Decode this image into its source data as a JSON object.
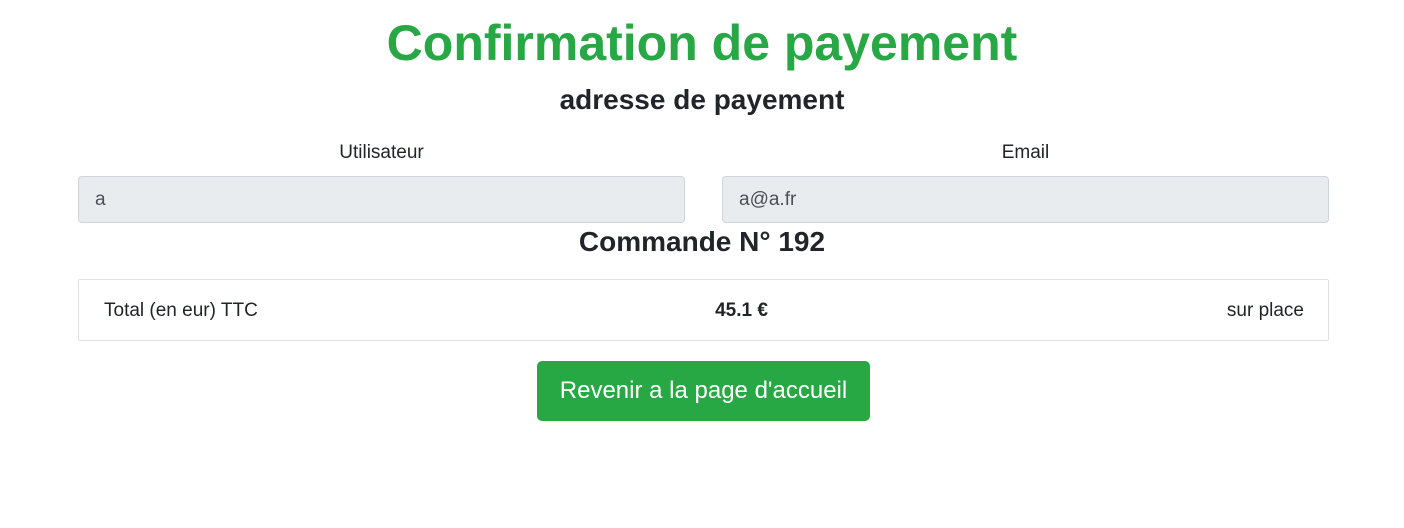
{
  "page": {
    "title": "Confirmation de payement",
    "subtitle": "adresse de payement"
  },
  "form": {
    "user_label": "Utilisateur",
    "user_value": "a",
    "email_label": "Email",
    "email_value": "a@a.fr"
  },
  "order": {
    "heading": "Commande N° 192",
    "total_label": "Total (en eur) TTC",
    "total_amount": "45.1 €",
    "delivery_mode": "sur place"
  },
  "actions": {
    "home_button_label": "Revenir a la page d'accueil"
  },
  "colors": {
    "accent": "#28a745",
    "input_background": "#e9ecef",
    "text": "#212529"
  }
}
